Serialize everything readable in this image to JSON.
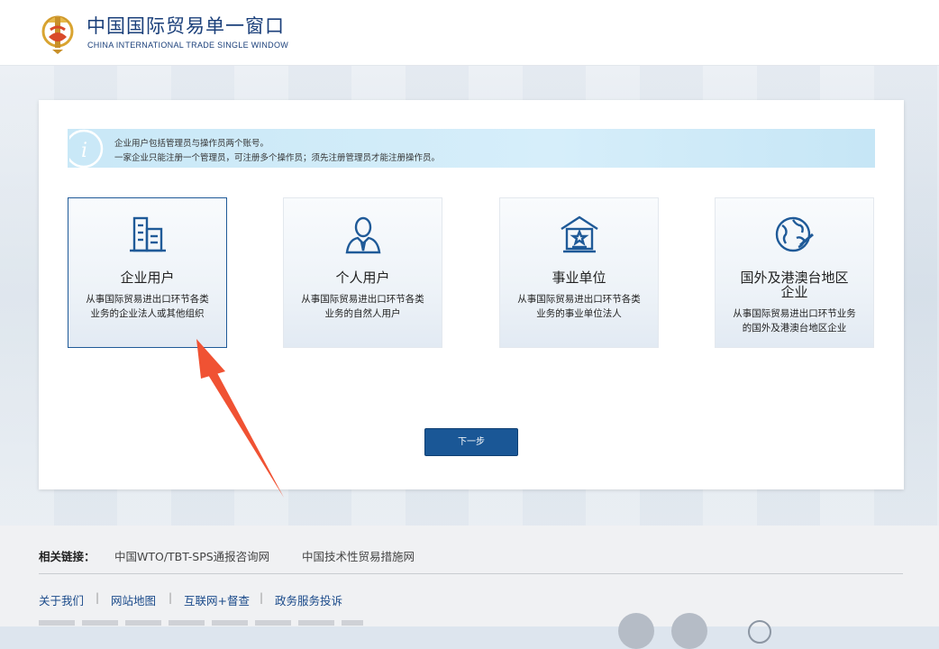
{
  "header": {
    "title_cn": "中国国际贸易单一窗口",
    "title_en": "CHINA INTERNATIONAL TRADE SINGLE WINDOW",
    "brand_color": "#1a3f7a"
  },
  "notice": {
    "line1": "企业用户包括管理员与操作员两个账号。",
    "line2": "一家企业只能注册一个管理员，可注册多个操作员；须先注册管理员才能注册操作员。",
    "icon": "info-icon"
  },
  "options": [
    {
      "title": "企业用户",
      "desc1": "从事国际贸易进出口环节各类",
      "desc2": "业务的企业法人或其他组织",
      "icon": "building-icon",
      "selected": true
    },
    {
      "title": "个人用户",
      "desc1": "从事国际贸易进出口环节各类",
      "desc2": "业务的自然人用户",
      "icon": "person-icon",
      "selected": false
    },
    {
      "title": "事业单位",
      "desc1": "从事国际贸易进出口环节各类",
      "desc2": "业务的事业单位法人",
      "icon": "institution-icon",
      "selected": false
    },
    {
      "title1": "国外及港澳台地区",
      "title2": "企业",
      "desc1": "从事国际贸易进出口环节业务",
      "desc2": "的国外及港澳台地区企业",
      "icon": "globe-icon",
      "selected": false
    }
  ],
  "next_button": {
    "label": "下一步"
  },
  "footer": {
    "links_label": "相关链接：",
    "links": [
      "中国WTO/TBT-SPS通报咨询网",
      "中国技术性贸易措施网"
    ],
    "nav": [
      "关于我们",
      "网站地图",
      "互联网+督查",
      "政务服务投诉"
    ],
    "separator": "|"
  },
  "colors": {
    "accent": "#1a5796",
    "selected_border": "#1f5a98",
    "arrow": "#f05233",
    "notice_bg": "#c9e8f7"
  }
}
